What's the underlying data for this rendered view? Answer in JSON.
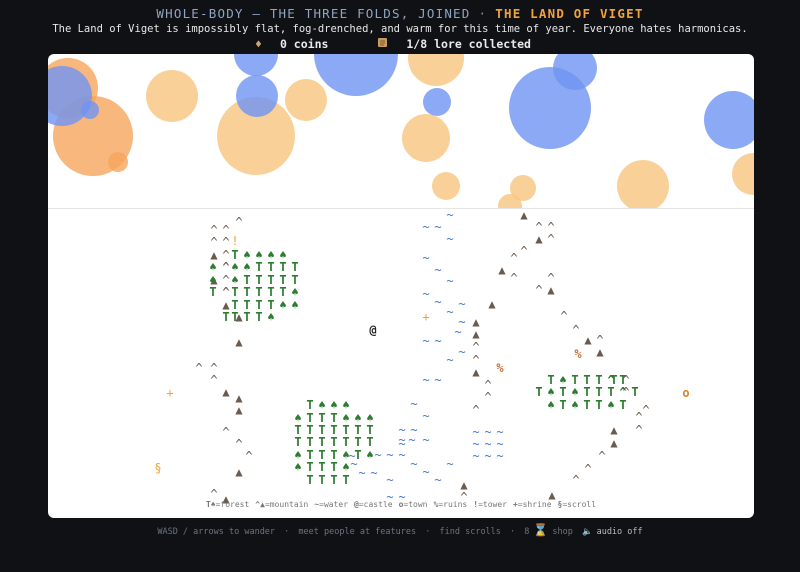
{
  "header": {
    "title_left": "WHOLE-BODY — THE THREE FOLDS, JOINED",
    "separator": "·",
    "title_right": "THE LAND OF VIGET",
    "tagline": "The Land of Viget is impossibly flat, fog-drenched, and warm for this time of year. Everyone hates harmonicas.",
    "coins_icon": "♦",
    "coins": "0 coins",
    "lore_icon": "scroll-icon",
    "lore": "1/8 lore collected"
  },
  "legend": [
    {
      "symbol": "T♠",
      "label": "=forest"
    },
    {
      "symbol": "^▲",
      "label": "=mountain"
    },
    {
      "symbol": "~",
      "label": "=water"
    },
    {
      "symbol": "@",
      "label": "=castle"
    },
    {
      "symbol": "o",
      "label": "=town"
    },
    {
      "symbol": "%",
      "label": "=ruins"
    },
    {
      "symbol": "!",
      "label": "=tower"
    },
    {
      "symbol": "+",
      "label": "=shrine"
    },
    {
      "symbol": "§",
      "label": "=scroll"
    }
  ],
  "footer": {
    "controls": "WASD / arrows to wander",
    "dot": "·",
    "meet": "meet people at features",
    "scrolls": "find scrolls",
    "shop_key": "8",
    "hourglass": "⌛",
    "shop": "shop",
    "audio_icon": "🔈",
    "audio": "audio off"
  },
  "colors": {
    "accent": "#f2a23a",
    "background": "#0f1115",
    "panel": "#ffffff",
    "tree": "#2e7d32",
    "water": "#3f78c9",
    "mountain": "#6b5a4e"
  }
}
